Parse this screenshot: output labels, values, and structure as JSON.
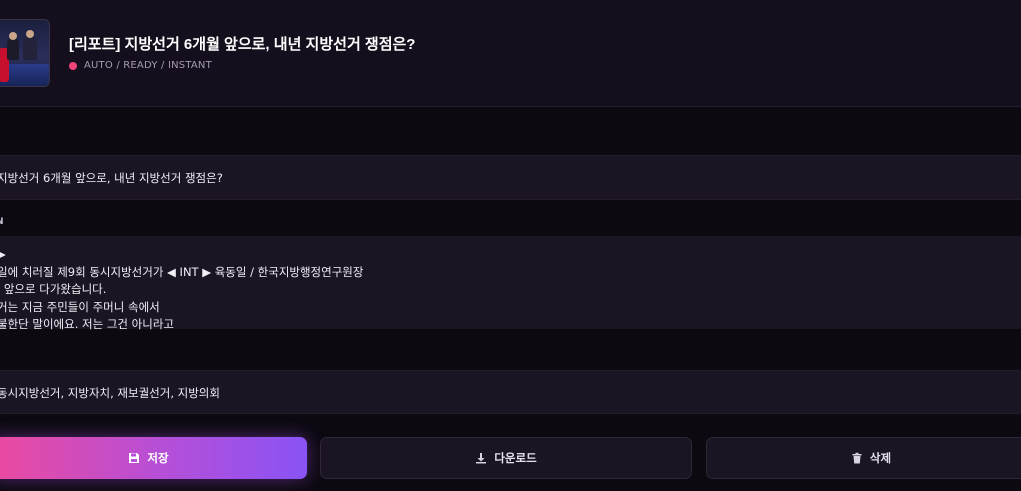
{
  "header": {
    "title": "[리포트] 지방선거 6개월 앞으로, 내년 지방선거 쟁점은?",
    "status": "AUTO / READY / INSTANT",
    "status_color": "#f0437a"
  },
  "fields": {
    "title_value": "지방선거 6개월 앞으로, 내년 지방선거 쟁점은?",
    "body_label": "N",
    "body_lines": [
      "▶",
      "일에 치러질 제9회 동시지방선거가 ◀ INT ▶ 육동일 / 한국지방행정연구원장",
      "l 앞으로 다가왔습니다.",
      "거는 지금 주민들이 주머니 속에서",
      "불한단 말이에요. 저는 그건 아니라고"
    ],
    "tags_value": "동시지방선거, 지방자치, 재보궐선거, 지방의회"
  },
  "actions": {
    "save_label": "저장",
    "save_icon": "floppy-disk-icon",
    "download_label": "다운로드",
    "download_icon": "download-icon",
    "delete_label": "삭제",
    "delete_icon": "trash-icon"
  },
  "colors": {
    "accent_start": "#ec4a9e",
    "accent_end": "#8a53f5",
    "background": "#0c0910",
    "panel": "#1b1422"
  }
}
